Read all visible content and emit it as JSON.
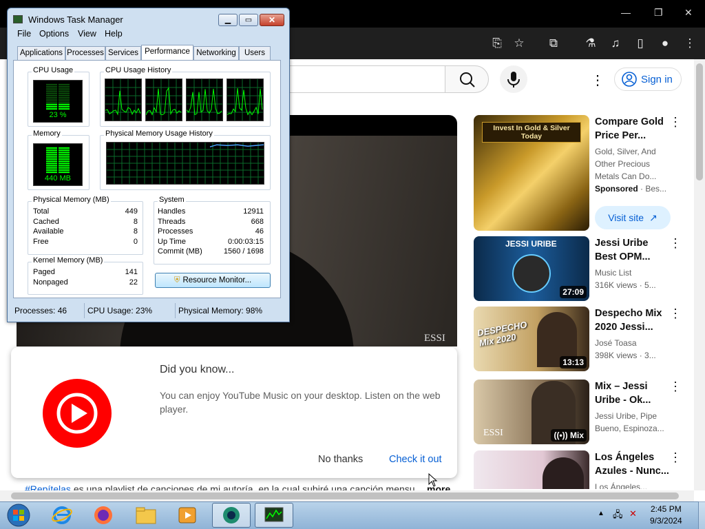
{
  "browser": {
    "window_controls": [
      "—",
      "❐",
      "✕"
    ]
  },
  "youtube": {
    "signin_label": "Sign in",
    "popup": {
      "title": "Did you know...",
      "body": "You can enjoy YouTube Music on your desktop. Listen on the web player.",
      "no_thanks": "No thanks",
      "check_out": "Check it out"
    },
    "description": {
      "hashtag": "#Repítelas",
      "text": " es una playlist de canciones de mi autoría, en la cual subiré una canción menşu...",
      "more": "more"
    },
    "sidebar": [
      {
        "title": "Compare Gold Price Per...",
        "meta1": "Gold, Silver, And Other Precious Metals Can Do...",
        "meta2": "Sponsored",
        "meta3": "· Bes...",
        "thumb_text": "Invest In Gold & Silver Today",
        "cta": "Visit site"
      },
      {
        "title": "Jessi Uribe Best OPM...",
        "meta1": "Music List",
        "meta2": "316K views · 5...",
        "duration": "27:09",
        "thumb_text": "JESSI URIBE"
      },
      {
        "title": "Despecho Mix 2020 Jessi...",
        "meta1": "José Toasa",
        "meta2": "398K views · 3...",
        "duration": "13:13",
        "thumb_text": "DESPECHO Mix 2020"
      },
      {
        "title": "Mix – Jessi Uribe - Ok...",
        "meta1": "Jessi Uribe, Pipe",
        "meta2": "Bueno, Espinoza...",
        "duration": "Mix",
        "thumb_text": "ESSI"
      },
      {
        "title": "Los Ángeles Azules - Nunc...",
        "meta1": "Los Ángeles..."
      }
    ],
    "watermark": "ESSI"
  },
  "task_manager": {
    "title": "Windows Task Manager",
    "menu": [
      "File",
      "Options",
      "View",
      "Help"
    ],
    "tabs": [
      "Applications",
      "Processes",
      "Services",
      "Performance",
      "Networking",
      "Users"
    ],
    "selected_tab": "Performance",
    "cpu_usage_label": "CPU Usage",
    "cpu_usage_value": "23 %",
    "cpu_history_label": "CPU Usage History",
    "memory_label": "Memory",
    "memory_value": "440 MB",
    "mem_history_label": "Physical Memory Usage History",
    "physical_memory": {
      "label": "Physical Memory (MB)",
      "rows": [
        [
          "Total",
          "449"
        ],
        [
          "Cached",
          "8"
        ],
        [
          "Available",
          "8"
        ],
        [
          "Free",
          "0"
        ]
      ]
    },
    "kernel_memory": {
      "label": "Kernel Memory (MB)",
      "rows": [
        [
          "Paged",
          "141"
        ],
        [
          "Nonpaged",
          "22"
        ]
      ]
    },
    "system": {
      "label": "System",
      "rows": [
        [
          "Handles",
          "12911"
        ],
        [
          "Threads",
          "668"
        ],
        [
          "Processes",
          "46"
        ],
        [
          "Up Time",
          "0:00:03:15"
        ],
        [
          "Commit (MB)",
          "1560 / 1698"
        ]
      ]
    },
    "resource_monitor": "Resource Monitor...",
    "status": {
      "processes": "Processes: 46",
      "cpu": "CPU Usage: 23%",
      "memory": "Physical Memory: 98%"
    },
    "cpu_level": 0.23,
    "memory_level": 0.98
  },
  "taskbar": {
    "time": "2:45 PM",
    "date": "9/3/2024"
  },
  "colors": {
    "youtube_red": "#ff0000",
    "link_blue": "#065fd4",
    "graph_green": "#00ff00"
  }
}
